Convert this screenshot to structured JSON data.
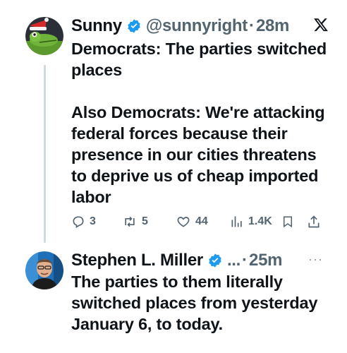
{
  "tweets": [
    {
      "author": {
        "name": "Sunny",
        "handle": "@sunnyright",
        "verified": true
      },
      "time": "28m",
      "separator": "·",
      "platform_icon": "x-logo",
      "paragraphs": [
        "Democrats: The parties switched places",
        "Also Democrats: We're attacking federal forces because their presence in our cities threatens to deprive us of cheap imported labor"
      ],
      "actions": {
        "replies": "3",
        "reposts": "5",
        "likes": "44",
        "views": "1.4K"
      }
    },
    {
      "author": {
        "name": "Stephen L. Miller",
        "handle": "...",
        "verified": true
      },
      "time": "25m",
      "separator": "·",
      "more_icon": "more-dots-icon",
      "paragraphs": [
        "The parties to them literally switched places from yesterday January 6, to today."
      ]
    }
  ],
  "colors": {
    "verified": "#1d9bf0",
    "text": "#0f1419",
    "muted": "#536471",
    "thread_line": "#cfd9de"
  }
}
